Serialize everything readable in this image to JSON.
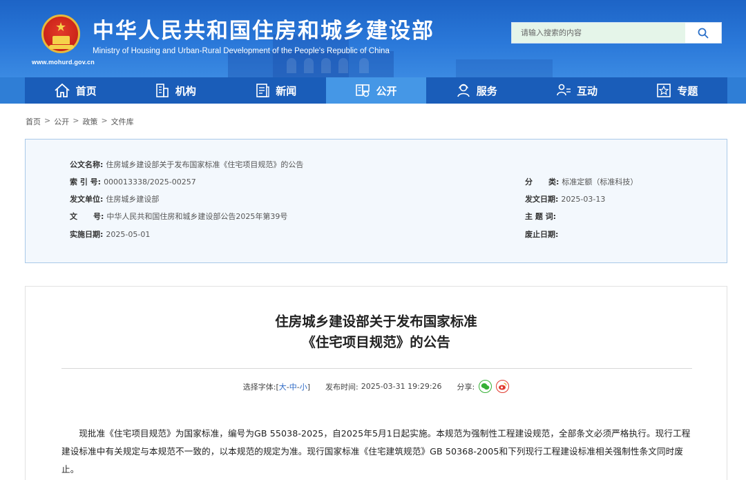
{
  "header": {
    "site_url": "www.mohurd.gov.cn",
    "title_cn": "中华人民共和国住房和城乡建设部",
    "title_en": "Ministry of Housing and Urban-Rural Development of the People's Republic of China",
    "search_placeholder": "请输入搜索的内容"
  },
  "nav": {
    "items": [
      {
        "label": "首页",
        "icon": "home-icon"
      },
      {
        "label": "机构",
        "icon": "building-icon"
      },
      {
        "label": "新闻",
        "icon": "news-icon"
      },
      {
        "label": "公开",
        "icon": "document-icon",
        "active": true
      },
      {
        "label": "服务",
        "icon": "service-icon"
      },
      {
        "label": "互动",
        "icon": "interaction-icon"
      },
      {
        "label": "专题",
        "icon": "topic-star-icon"
      }
    ]
  },
  "breadcrumb": [
    "首页",
    "公开",
    "政策",
    "文件库"
  ],
  "info": {
    "title_key": "公文名称:",
    "title_val": "住房城乡建设部关于发布国家标准《住宅项目规范》的公告",
    "index_key": "索 引 号:",
    "index_val": "000013338/2025-00257",
    "issuer_key": "发文单位:",
    "issuer_val": "住房城乡建设部",
    "docno_key": "文      号:",
    "docno_val": "中华人民共和国住房和城乡建设部公告2025年第39号",
    "effective_key": "实施日期:",
    "effective_val": "2025-05-01",
    "category_key": "分      类:",
    "category_val": "标准定额（标准科技）",
    "pubdate_key": "发文日期:",
    "pubdate_val": "2025-03-13",
    "keywords_key": "主 题 词:",
    "keywords_val": "",
    "expire_key": "废止日期:",
    "expire_val": ""
  },
  "article": {
    "title_line1": "住房城乡建设部关于发布国家标准",
    "title_line2": "《住宅项目规范》的公告",
    "font_label": "选择字体:",
    "font_open": "[",
    "font_large": "大",
    "font_sep1": "-",
    "font_medium": "中",
    "font_sep2": "-",
    "font_small": "小",
    "font_close": "]",
    "publish_label": "发布时间:",
    "publish_time": "2025-03-31 19:29:26",
    "share_label": "分享:",
    "paragraph": "现批准《住宅项目规范》为国家标准，编号为GB 55038-2025，自2025年5月1日起实施。本规范为强制性工程建设规范，全部条文必须严格执行。现行工程建设标准中有关规定与本规范不一致的，以本规范的规定为准。现行国家标准《住宅建筑规范》GB 50368-2005和下列现行工程建设标准相关强制性条文同时废止。"
  },
  "colors": {
    "header_blue": "#1d64c6",
    "nav_blue": "#1a5db9",
    "nav_active": "#4597e6",
    "info_bg": "#f3f8fd",
    "link_blue": "#2a67c5"
  }
}
